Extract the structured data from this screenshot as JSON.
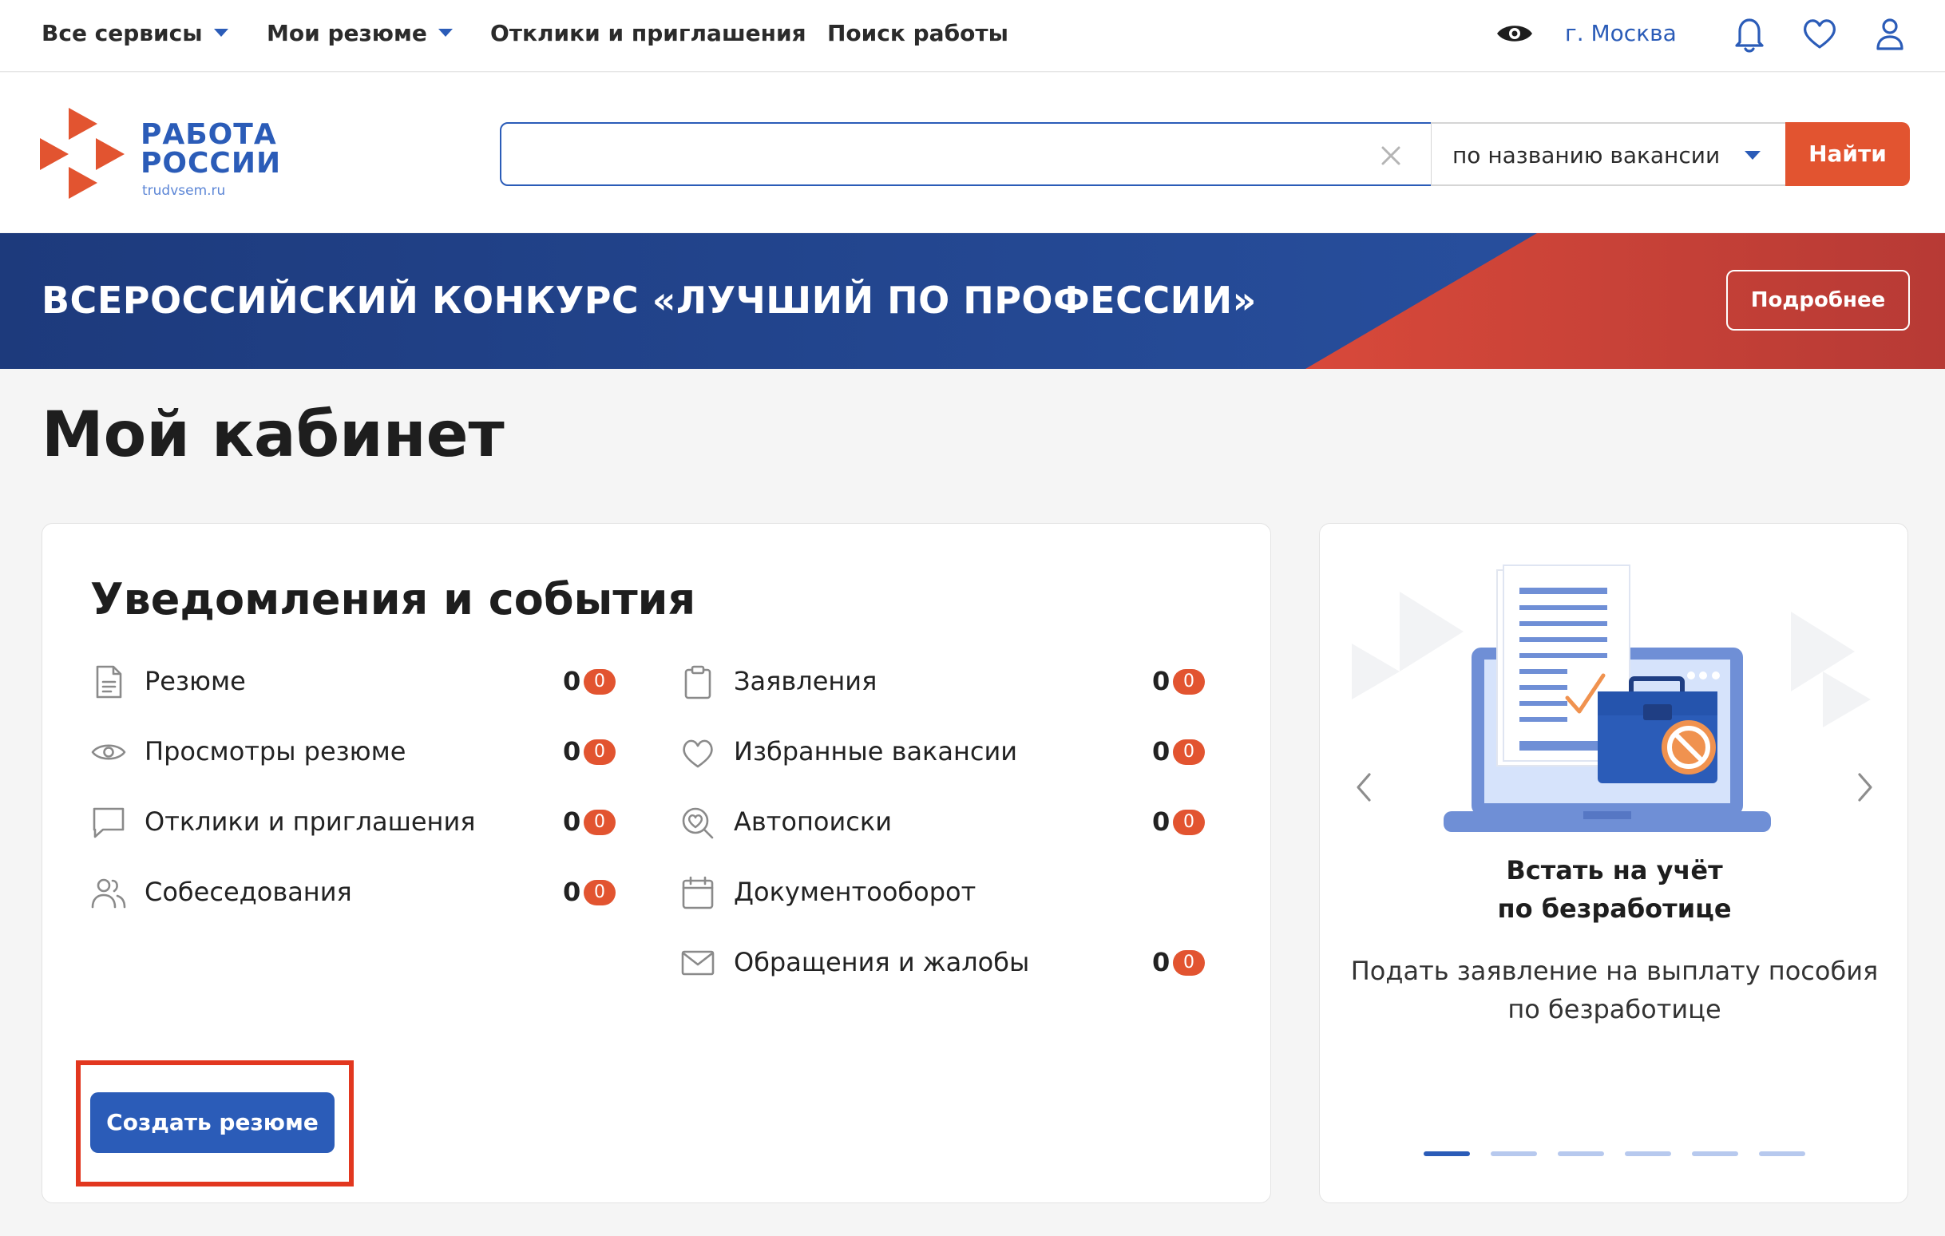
{
  "topnav": {
    "all_services": "Все сервисы",
    "my_resumes": "Мои резюме",
    "responses": "Отклики и приглашения",
    "job_search": "Поиск работы",
    "city": "г. Москва"
  },
  "logo": {
    "line1": "РАБОТА",
    "line2": "РОССИИ",
    "url": "trudvsem.ru"
  },
  "search": {
    "value": "",
    "placeholder": "",
    "mode": "по названию вакансии",
    "button": "Найти"
  },
  "banner": {
    "title": "ВСЕРОССИЙСКИЙ КОНКУРС «ЛУЧШИЙ ПО ПРОФЕССИИ»",
    "button": "Подробнее"
  },
  "page": {
    "title": "Мой кабинет"
  },
  "notifications": {
    "title": "Уведомления и события",
    "left": [
      {
        "label": "Резюме",
        "count": "0",
        "badge": "0",
        "icon": "document-icon"
      },
      {
        "label": "Просмотры резюме",
        "count": "0",
        "badge": "0",
        "icon": "eye-icon"
      },
      {
        "label": "Отклики и приглашения",
        "count": "0",
        "badge": "0",
        "icon": "chat-icon"
      },
      {
        "label": "Собеседования",
        "count": "0",
        "badge": "0",
        "icon": "people-icon"
      }
    ],
    "right": [
      {
        "label": "Заявления",
        "count": "0",
        "badge": "0",
        "icon": "clipboard-icon"
      },
      {
        "label": "Избранные вакансии",
        "count": "0",
        "badge": "0",
        "icon": "heart-icon"
      },
      {
        "label": "Автопоиски",
        "count": "0",
        "badge": "0",
        "icon": "heart-search-icon"
      },
      {
        "label": "Документооборот",
        "icon": "calendar-icon"
      },
      {
        "label": "Обращения и жалобы",
        "count": "0",
        "badge": "0",
        "icon": "envelope-icon"
      }
    ],
    "create_button": "Создать резюме"
  },
  "promo": {
    "title_line1": "Встать на учёт",
    "title_line2": "по безработице",
    "subtitle_line1": "Подать заявление на выплату пособия",
    "subtitle_line2": "по безработице",
    "slides_total": 6,
    "active_slide": 1
  },
  "colors": {
    "brand_blue": "#2b5cb8",
    "accent_red": "#e25430",
    "banner_blue": "#1f3e83",
    "banner_red": "#c6433a"
  }
}
